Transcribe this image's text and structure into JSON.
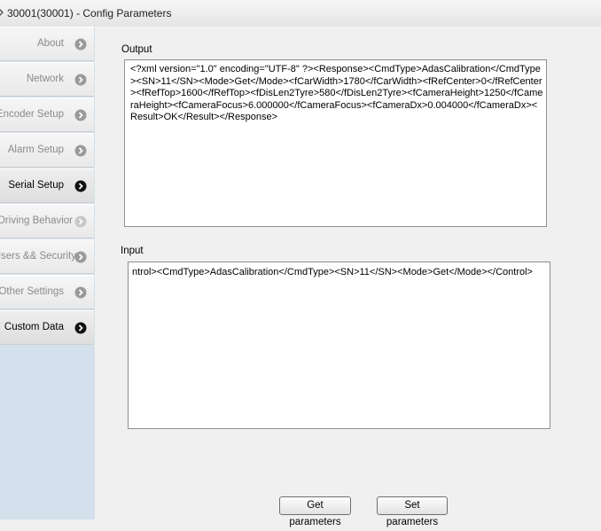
{
  "window": {
    "title": "30001(30001) - Config Parameters"
  },
  "sidebar": {
    "items": [
      {
        "label": "About"
      },
      {
        "label": "Network"
      },
      {
        "label": "Encoder Setup"
      },
      {
        "label": "Alarm Setup"
      },
      {
        "label": "Serial Setup"
      },
      {
        "label": "Driving Behavior"
      },
      {
        "label": "Users && Security"
      },
      {
        "label": "Other Settings"
      },
      {
        "label": "Custom Data"
      }
    ]
  },
  "output": {
    "label": "Output",
    "text": "<?xml version=\"1.0\" encoding=\"UTF-8\" ?><Response><CmdType>AdasCalibration</CmdType><SN>11</SN><Mode>Get</Mode><fCarWidth>1780</fCarWidth><fRefCenter>0</fRefCenter><fRefTop>1600</fRefTop><fDisLen2Tyre>580</fDisLen2Tyre><fCameraHeight>1250</fCameraHeight><fCameraFocus>6.000000</fCameraFocus><fCameraDx>0.004000</fCameraDx><Result>OK</Result></Response>"
  },
  "input": {
    "label": "Input",
    "text": "ntrol><CmdType>AdasCalibration</CmdType><SN>11</SN><Mode>Get</Mode></Control>"
  },
  "buttons": {
    "get_label": "Get parameters",
    "set_label": "Set parameters"
  }
}
